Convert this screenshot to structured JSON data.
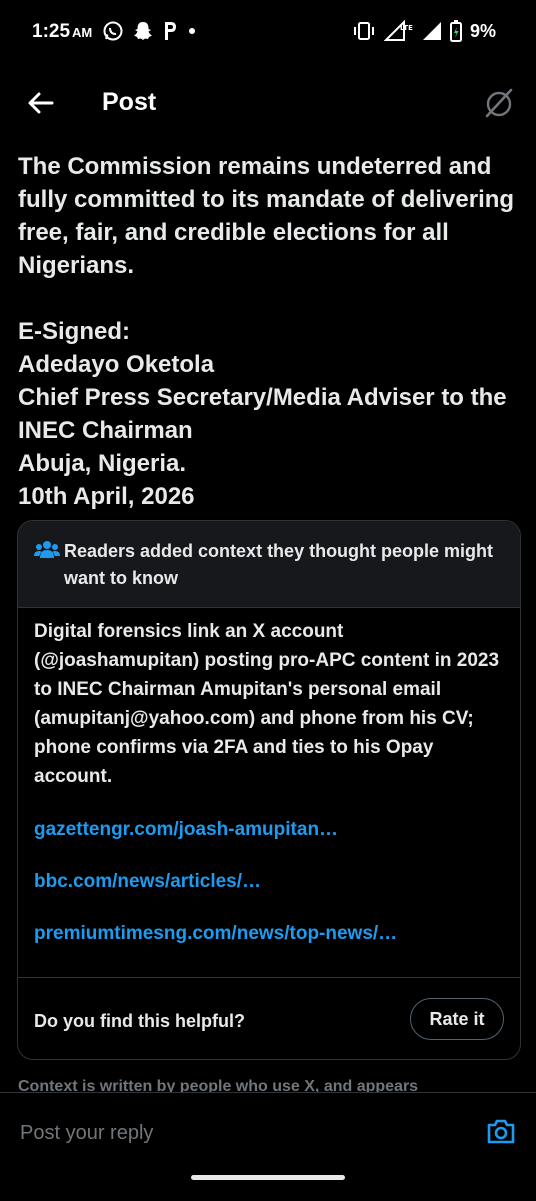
{
  "status_bar": {
    "time": "1:25",
    "ampm": "AM",
    "left_icons": [
      "whatsapp-icon",
      "snapchat-icon",
      "p-app-icon",
      "dot-icon"
    ],
    "right_icons": [
      "vibrate-icon",
      "lte-signal-icon",
      "signal-icon",
      "battery-icon"
    ],
    "lte_label": "LTE",
    "battery_percent": "9%"
  },
  "header": {
    "title": "Post",
    "back_icon": "arrow-left-icon",
    "grok_icon": "grok-icon"
  },
  "post": {
    "paragraph1": "The Commission remains undeterred and fully committed to its mandate of delivering free, fair, and credible elections for all Nigerians.",
    "sign_lines": [
      "E-Signed:",
      "Adedayo Oketola",
      "Chief Press Secretary/Media Adviser to the INEC Chairman",
      "Abuja, Nigeria.",
      "10th April, 2026"
    ]
  },
  "community_note": {
    "header_icon": "people-icon",
    "header": "Readers added context they thought people might want to know",
    "body": "Digital forensics link an X account (@joashamupitan) posting pro-APC content in 2023 to INEC Chairman Amupitan's personal email (amupitanj@yahoo.com) and phone from his CV; phone confirms via 2FA and ties to his Opay account.",
    "links": [
      "gazettengr.com/joash-amupitan…",
      "bbc.com/news/articles/…",
      "premiumtimesng.com/news/top-news/…"
    ],
    "helpful_question": "Do you find this helpful?",
    "rate_button": "Rate it"
  },
  "footnote": "Context is written by people who use X, and appears",
  "reply": {
    "placeholder": "Post your reply",
    "camera_icon": "camera-icon"
  },
  "colors": {
    "background": "#000000",
    "text": "#e7e9ea",
    "link": "#1d9bf0",
    "note_header_bg": "#16181c",
    "border": "#2f3336",
    "muted": "#71767b"
  }
}
